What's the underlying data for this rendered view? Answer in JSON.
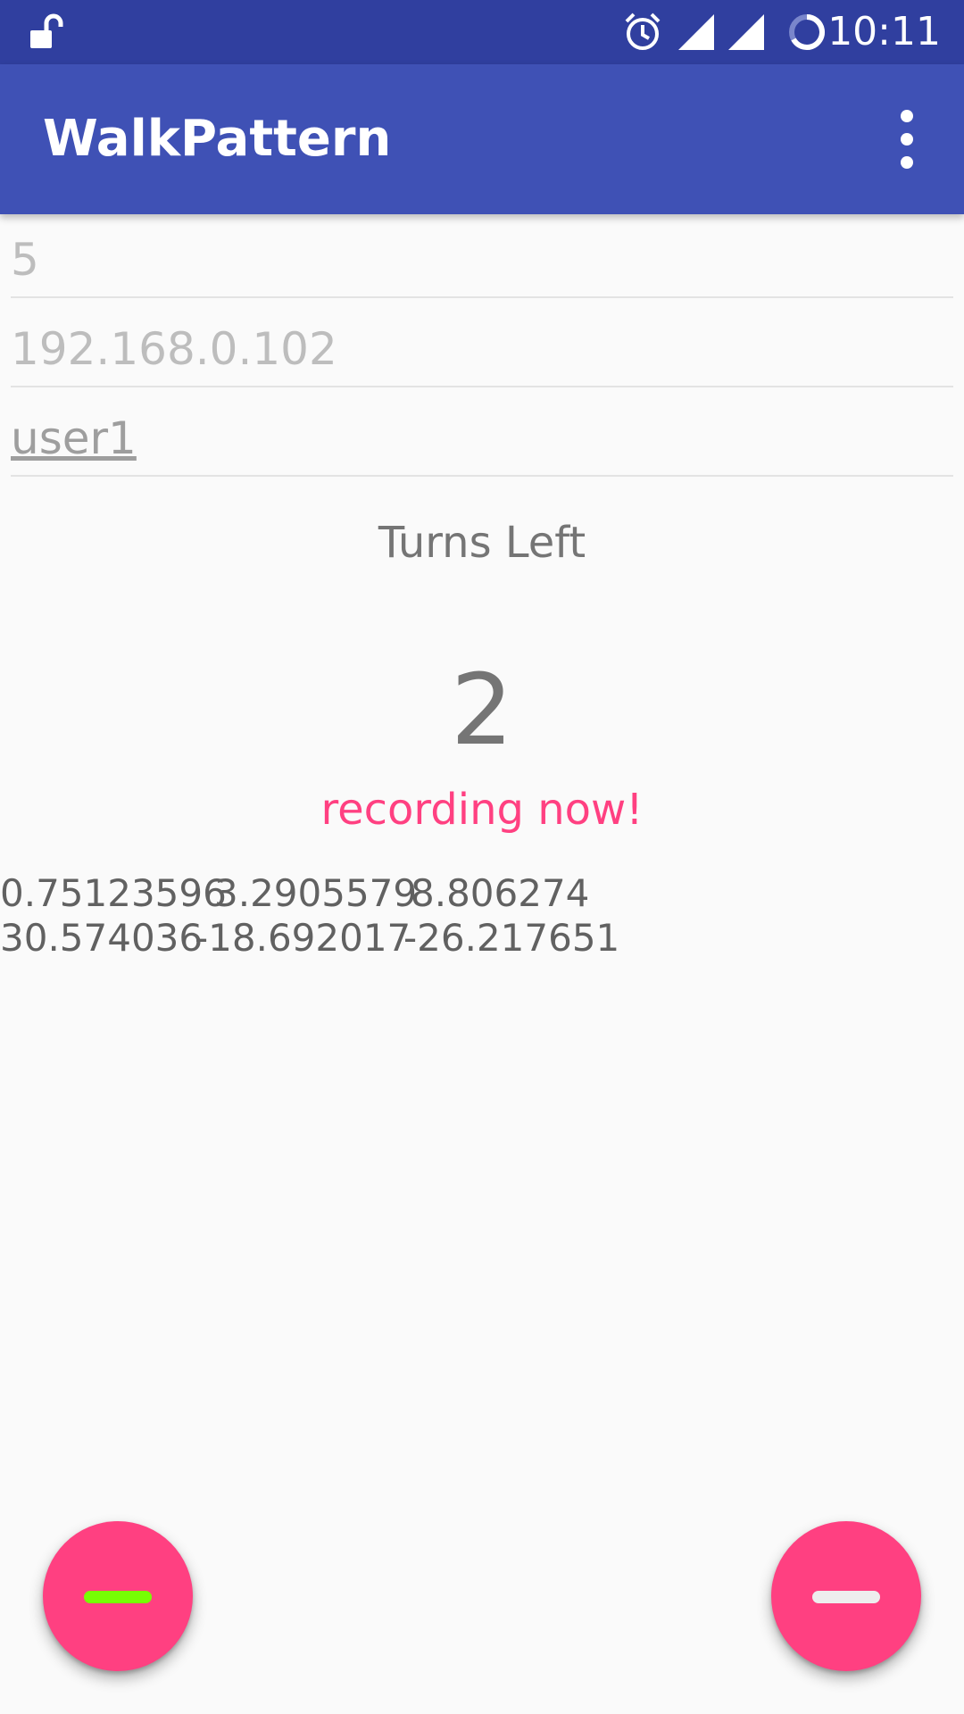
{
  "status_bar": {
    "time": "10:11",
    "icons": [
      "unlock-icon",
      "alarm-icon",
      "signal-icon",
      "signal-icon",
      "sync-icon"
    ]
  },
  "app_bar": {
    "title": "WalkPattern",
    "overflow_icon": "more-vert-icon"
  },
  "fields": {
    "number": "5",
    "ip": "192.168.0.102",
    "user": "user1"
  },
  "turns": {
    "label": "Turns Left",
    "count": "2"
  },
  "recording_text": "recording now!",
  "sensor": {
    "row1": [
      "0.75123596",
      "3.2905579",
      "8.806274"
    ],
    "row2": [
      "30.574036",
      "-18.692017",
      "-26.217651"
    ]
  },
  "fabs": {
    "left_icon": "minus-icon",
    "right_icon": "minus-icon"
  },
  "colors": {
    "status_bar": "#303f9f",
    "app_bar": "#3f51b5",
    "accent": "#ff4081",
    "left_fab_icon": "#76ff03",
    "right_fab_icon": "#eeeeee"
  }
}
